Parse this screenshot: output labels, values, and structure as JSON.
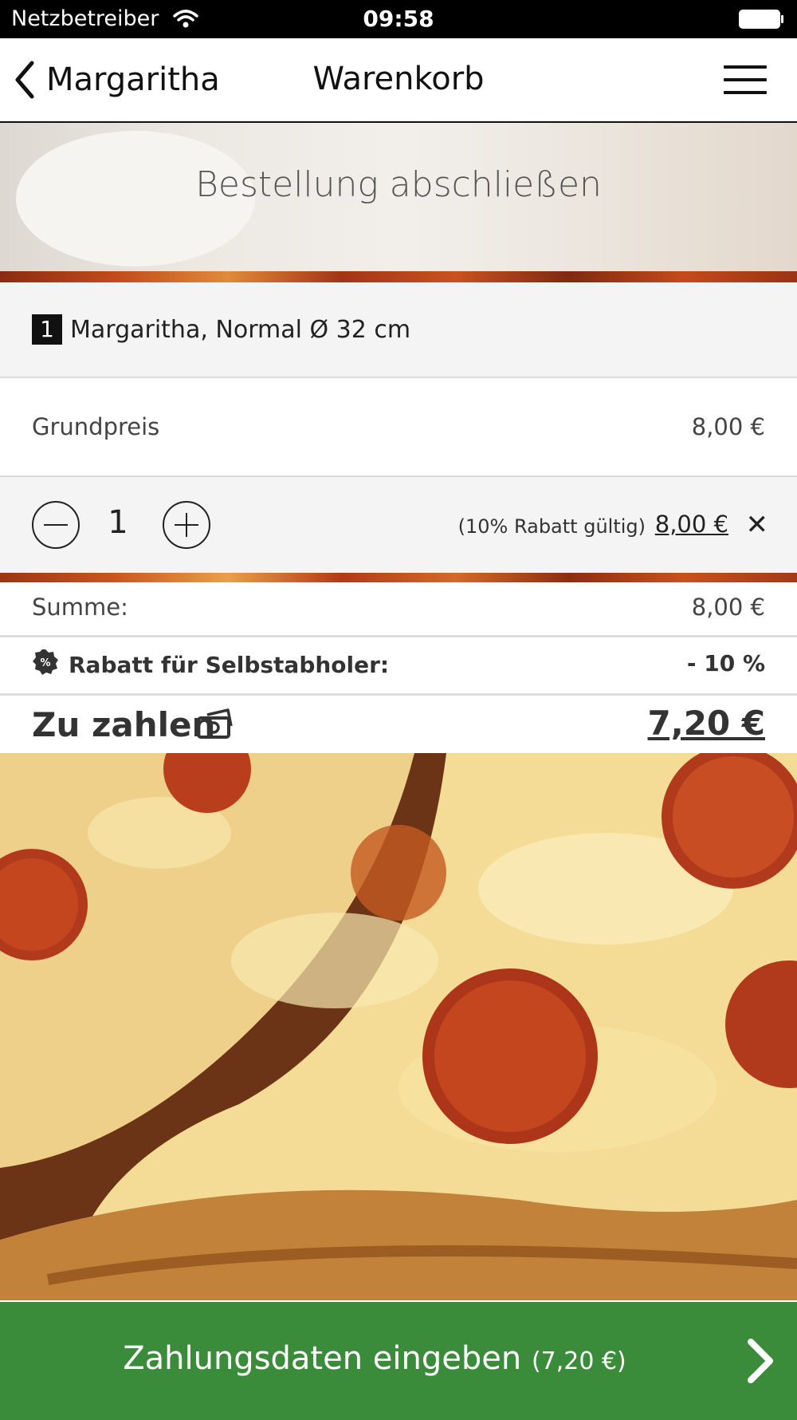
{
  "status_bar": {
    "carrier": "Netzbetreiber",
    "time": "09:58"
  },
  "nav": {
    "back_label": "Margaritha",
    "title": "Warenkorb"
  },
  "hero": {
    "title": "Bestellung abschließen"
  },
  "cart_item": {
    "quantity_badge": "1",
    "name": "Margaritha, Normal Ø 32 cm",
    "base_price_label": "Grundpreis",
    "base_price": "8,00 €",
    "quantity": "1",
    "discount_note": "(10% Rabatt gültig)",
    "line_price": "8,00 €"
  },
  "summary": {
    "sum_label": "Summe:",
    "sum_value": "8,00 €",
    "rebate_label": "Rabatt für Selbstabholer:",
    "rebate_value": "- 10 %",
    "total_label": "Zu zahlen",
    "total_value": "7,20 €"
  },
  "footer": {
    "button_label": "Zahlungsdaten eingeben",
    "button_amount": "(7,20 €)"
  },
  "colors": {
    "pay_button": "#3a8c3b",
    "status_bar": "#000000",
    "item_background": "#f4f4f4"
  },
  "icons": {
    "back": "chevron-left-icon",
    "menu": "hamburger-menu-icon",
    "minus": "minus-circle-icon",
    "plus": "plus-circle-icon",
    "remove": "close-icon",
    "rebate": "percent-badge-icon",
    "total": "money-icon",
    "pay": "chevron-right-icon"
  }
}
